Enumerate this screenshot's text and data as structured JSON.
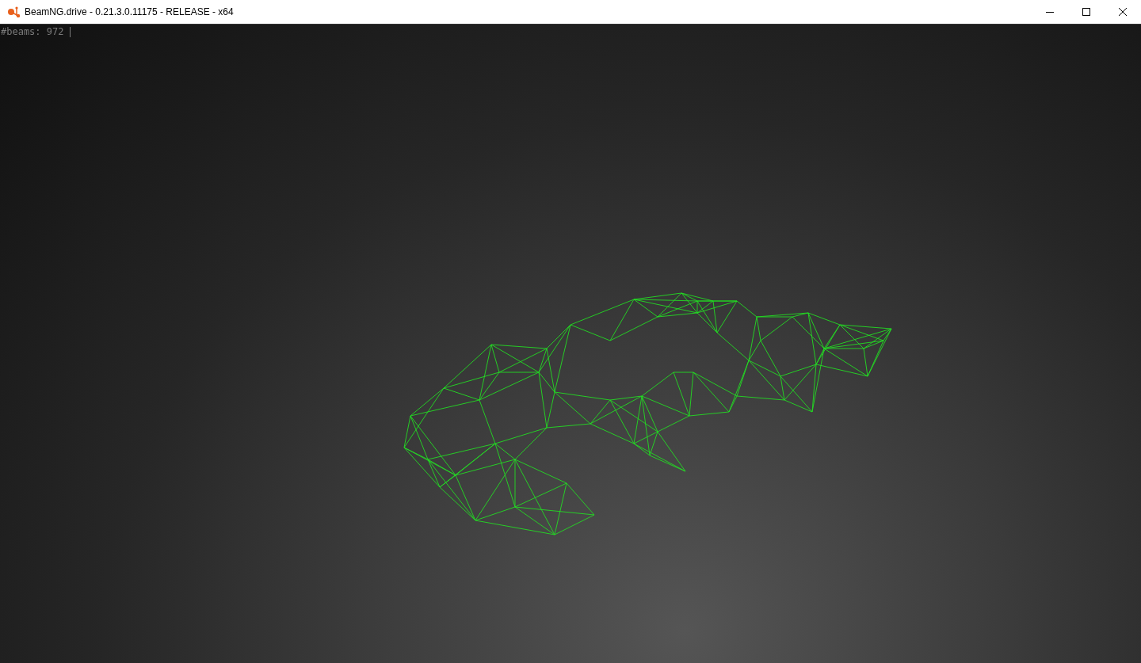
{
  "window": {
    "title": "BeamNG.drive - 0.21.3.0.11175 - RELEASE - x64"
  },
  "overlay": {
    "text": "#beams: 972"
  }
}
